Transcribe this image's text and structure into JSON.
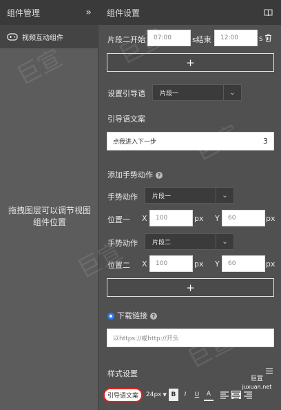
{
  "left": {
    "title": "组件管理",
    "collapse_glyph": "»",
    "component_item": "视频互动组件",
    "hint": "拖拽图层可以调节视图组件位置"
  },
  "right": {
    "title": "组件设置",
    "segment": {
      "label_start": "片段二开始",
      "start_value": "07:00",
      "sep": "s结束",
      "end_value": "12:00",
      "unit": "s"
    },
    "add1": "+",
    "guide_label": "设置引导语",
    "guide_select": "片段一",
    "guide_text_label": "引导语文案",
    "guide_text_value": "点我进入下一步",
    "guide_text_count": "3",
    "gesture_title": "添加手势动作",
    "gesture1": {
      "label": "手势动作",
      "select": "片段一",
      "pos_label": "位置一",
      "x_label": "X",
      "x": "100",
      "px1": "px",
      "y_label": "Y",
      "y": "60",
      "px2": "px"
    },
    "gesture2": {
      "label": "手势动作",
      "select": "片段二",
      "pos_label": "位置二",
      "x_label": "X",
      "x": "100",
      "px1": "px",
      "y_label": "Y",
      "y": "60",
      "px2": "px"
    },
    "add2": "+",
    "download_label": "下载链接",
    "download_placeholder": "以https://或http://开头",
    "style_title": "样式设置",
    "toolbar": {
      "text_type": "引导语文案",
      "font_size": "24px",
      "bold": "B",
      "italic": "I",
      "underline": "U",
      "color": "A"
    }
  },
  "watermark": {
    "text": "巨宣",
    "site": "juxuan.net"
  },
  "colors": {
    "accent": "#2d7cf5",
    "highlight": "#e0231c",
    "panel": "#505050"
  }
}
